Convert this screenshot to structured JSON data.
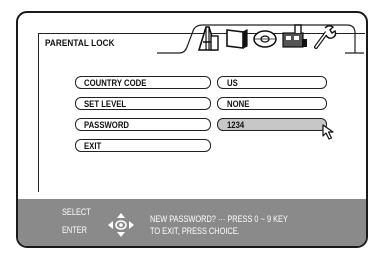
{
  "menu": {
    "title": "PARENTAL LOCK",
    "tab_icons": [
      "speaker-icon",
      "display-icon",
      "disc-icon",
      "plug-icon",
      "wrench-icon"
    ],
    "rows": [
      {
        "label": "COUNTRY CODE",
        "value": "US"
      },
      {
        "label": "SET LEVEL",
        "value": "NONE"
      },
      {
        "label": "PASSWORD",
        "value": "1234"
      },
      {
        "label": "EXIT",
        "value": ""
      }
    ],
    "selected_row": "PASSWORD",
    "cursor_icon": "pointer-cursor-icon"
  },
  "footer": {
    "select_label": "SELECT",
    "enter_label": "ENTER",
    "joystick_icon": "direction-pad-icon",
    "line1": "NEW PASSWORD? ··· PRESS 0 ~ 9 KEY",
    "line2": "TO EXIT, PRESS CHOICE."
  }
}
